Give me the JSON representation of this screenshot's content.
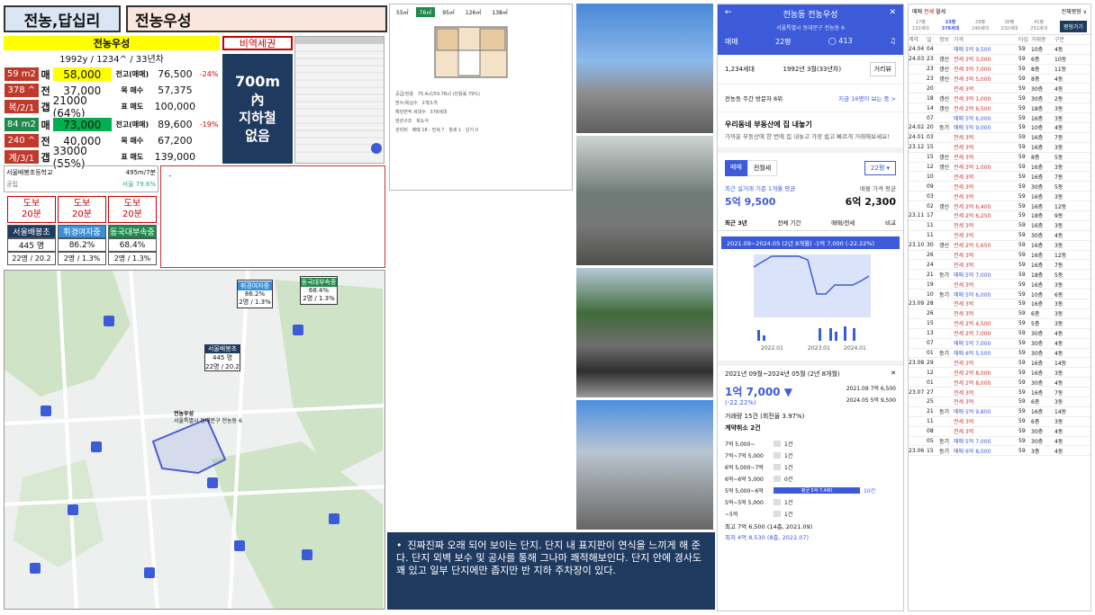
{
  "header": {
    "title": "전농,답십리",
    "complex": "전농우성"
  },
  "info": {
    "name": "전농우성",
    "year": "1992y / 1234^ / 33년차",
    "bidx": "비역세권",
    "subway": [
      "700m",
      "內",
      "지하철",
      "없음"
    ],
    "rows": [
      {
        "left": "59 m2",
        "k": "매",
        "v": "58,000",
        "n": "전고(매매)",
        "p": "76,500",
        "r": "-24%",
        "lc": "#c0392b",
        "vc": "#ffff00"
      },
      {
        "left": "378 ^",
        "k": "전",
        "v": "37,000",
        "n": "목 매수",
        "p": "57,375",
        "r": "",
        "lc": "#c0392b",
        "vc": "#fff"
      },
      {
        "left": "복/2/1",
        "k": "갭",
        "v": "21000 (64%)",
        "n": "표 매도",
        "p": "100,000",
        "r": "",
        "lc": "#c0392b",
        "vc": "#fff"
      },
      {
        "left": "84 m2",
        "k": "매",
        "v": "73,000",
        "n": "전고(매매)",
        "p": "89,600",
        "r": "-19%",
        "lc": "#1f8a4c",
        "vc": "#00b050"
      },
      {
        "left": "240 ^",
        "k": "전",
        "v": "40,000",
        "n": "목 매수",
        "p": "67,200",
        "r": "",
        "lc": "#c0392b",
        "vc": "#fff"
      },
      {
        "left": "계/3/1",
        "k": "갭",
        "v": "33000 (55%)",
        "n": "표 매도",
        "p": "139,000",
        "r": "",
        "lc": "#c0392b",
        "vc": "#fff"
      }
    ]
  },
  "school": {
    "name": "서울배봉초등학교",
    "dist": "495m/7분",
    "tag": "공립",
    "sub": "서울 79.6%"
  },
  "walk": [
    {
      "l1": "도보",
      "l2": "20분"
    },
    {
      "l1": "도보",
      "l2": "20분"
    },
    {
      "l1": "도보",
      "l2": "20분"
    }
  ],
  "schools": [
    {
      "name": "서울배봉초",
      "pct": "445 명",
      "ratio": "22명 / 20.2",
      "color": "#1f3a5f"
    },
    {
      "name": "휘경여자중",
      "pct": "86.2%",
      "ratio": "2명 / 1.3%",
      "color": "#3a8fd8"
    },
    {
      "name": "동국대부속중",
      "pct": "68.4%",
      "ratio": "2명 / 1.3%",
      "color": "#1f8a4c"
    }
  ],
  "map": {
    "m1": [
      "휘경여자중",
      "86.2%",
      "2명 / 1.3%"
    ],
    "m2": [
      "동국대부속중",
      "68.4%",
      "2명 / 1.3%"
    ],
    "m3": [
      "서울배봉초",
      "445 명",
      "22명 / 20.2"
    ],
    "complex": "전농우성",
    "addr": "서울특별시 동대문구 전농동 6"
  },
  "plan": {
    "tabs": [
      "55㎡",
      "76㎡",
      "95㎡",
      "126㎡",
      "138㎡"
    ]
  },
  "note": "진짜진짜 오래 되어 보이는 단지. 단지 내 표지판이 연식을 느끼게 해 준다. 단지 외벽 보수 및 공사를 통해 그나마 쾌적해보인다. 단지 안에 경사도 꽤 있고 일부 단지에만 좁지만 반 지하 주차장이 있다.",
  "app": {
    "title": "전농동 전농우성",
    "addr": "서울특별시 동대문구 전농동 6",
    "trade": "매매",
    "size": "22평",
    "count": "413",
    "households": "1,234세대",
    "built": "1992년 3월(33년차)",
    "btn": "거리뷰",
    "visit": "전농동 주간 방문자 8위",
    "visit_link": "지금 16명이 보는 중 >",
    "ad_title": "우리동네 부동산에 집 내놓기",
    "ad_body": "가까운 부동산에 한 번에 집 내놓고 가장 쉽고 빠르게 거래해보세요!",
    "tabs": [
      "매매",
      "전월세"
    ],
    "size2": "22평 ▾",
    "recent_label": "최근 실거래 기준 1개월 평균",
    "recent_val": "5억 9,500",
    "ask_label": "매물 가격 평균",
    "ask_val": "6억 2,300",
    "ptabs": [
      "최근 3년",
      "전체 기간",
      "매매/전세",
      "비교"
    ],
    "range": "2021.09~2024.05 (2년 8개월)  -1억 7,000 (-22.22%)",
    "xaxis": [
      "2022.01",
      "2023.01",
      "2024.01"
    ],
    "sum_title": "2021년 09월~2024년 05월 (2년 8개월)",
    "sum_val": "1억 7,000 ▼",
    "sum_pct": "(-22.22%)",
    "sum_a": "2021.09  7억 6,500",
    "sum_b": "2024.05  5억 9,500",
    "cnt": "거래량 15건 (회전율 3.97%)",
    "cancel": "계약취소 2건",
    "bands": [
      [
        "7억 5,000~",
        "1건"
      ],
      [
        "7억~7억 5,000",
        "1건"
      ],
      [
        "6억 5,000~7억",
        "1건"
      ],
      [
        "6억~6억 5,000",
        "0건"
      ],
      [
        "5억 5,000~6억",
        "10건"
      ],
      [
        "5억~5억 5,000",
        "1건"
      ],
      [
        "~5억",
        "1건"
      ]
    ],
    "bar_label": "평균 5억 7,480",
    "hi": "최고 7억 6,500 (14층, 2021.09)",
    "lo": "최저 4억 8,530 (8층, 2022.07)"
  },
  "list": {
    "tabs": [
      "매매",
      "전세",
      "월세"
    ],
    "filter": "전체평형 ∨",
    "sizes": [
      [
        "17평",
        "132세대"
      ],
      [
        "23평",
        "378세대"
      ],
      [
        "29평",
        "240세대"
      ],
      [
        "30평",
        "232세대"
      ],
      [
        "41평",
        "252세대"
      ]
    ],
    "btn": "평형가기",
    "head": [
      "계약",
      "일",
      "정보",
      "가격",
      "타입",
      "거래층",
      "구분"
    ],
    "rows": [
      [
        "24.04",
        "04",
        "",
        "매매 5억 9,500",
        "59",
        "10층",
        "4동"
      ],
      [
        "24.03",
        "23",
        "갱신",
        "전세 3억 3,000",
        "59",
        "6층",
        "10동"
      ],
      [
        "",
        "23",
        "갱신",
        "전세 3억 7,000",
        "59",
        "8층",
        "11동"
      ],
      [
        "",
        "23",
        "갱신",
        "전세 3억 5,000",
        "59",
        "8층",
        "4동"
      ],
      [
        "",
        "20",
        "",
        "전세 3억",
        "59",
        "30층",
        "4동"
      ],
      [
        "",
        "18",
        "갱신",
        "전세 3억 1,000",
        "59",
        "30층",
        "2동"
      ],
      [
        "",
        "14",
        "갱신",
        "전세 2억 6,500",
        "59",
        "18층",
        "3동"
      ],
      [
        "",
        "07",
        "",
        "매매 5억 6,000",
        "59",
        "16층",
        "3동"
      ],
      [
        "24.02",
        "20",
        "등기",
        "매매 5억 9,000",
        "59",
        "10층",
        "4동"
      ],
      [
        "24.01",
        "03",
        "",
        "전세 3억",
        "59",
        "16층",
        "7동"
      ],
      [
        "23.12",
        "15",
        "",
        "전세 3억",
        "59",
        "16층",
        "3동"
      ],
      [
        "",
        "15",
        "갱신",
        "전세 3억",
        "59",
        "8층",
        "5동"
      ],
      [
        "",
        "12",
        "갱신",
        "전세 3억 1,000",
        "59",
        "16층",
        "3동"
      ],
      [
        "",
        "10",
        "",
        "전세 3억",
        "59",
        "16층",
        "7동"
      ],
      [
        "",
        "09",
        "",
        "전세 3억",
        "59",
        "30층",
        "5동"
      ],
      [
        "",
        "03",
        "",
        "전세 3억",
        "59",
        "16층",
        "3동"
      ],
      [
        "",
        "02",
        "갱신",
        "전세 2억 6,400",
        "59",
        "16층",
        "12동"
      ],
      [
        "23.11",
        "17",
        "",
        "전세 2억 6,250",
        "59",
        "18층",
        "9동"
      ],
      [
        "",
        "11",
        "",
        "전세 3억",
        "59",
        "16층",
        "3동"
      ],
      [
        "",
        "11",
        "",
        "전세 3억",
        "59",
        "30층",
        "4동"
      ],
      [
        "23.10",
        "30",
        "갱신",
        "전세 2억 5,650",
        "59",
        "16층",
        "3동"
      ],
      [
        "",
        "26",
        "",
        "전세 3억",
        "59",
        "16층",
        "12동"
      ],
      [
        "",
        "24",
        "",
        "전세 3억",
        "59",
        "16층",
        "7동"
      ],
      [
        "",
        "21",
        "등기",
        "매매 5억 7,000",
        "59",
        "18층",
        "5동"
      ],
      [
        "",
        "19",
        "",
        "전세 3억",
        "59",
        "16층",
        "3동"
      ],
      [
        "",
        "10",
        "등기",
        "매매 5억 6,000",
        "59",
        "10층",
        "6동"
      ],
      [
        "23.09",
        "28",
        "",
        "전세 3억",
        "59",
        "16층",
        "3동"
      ],
      [
        "",
        "26",
        "",
        "전세 3억",
        "59",
        "6층",
        "3동"
      ],
      [
        "",
        "15",
        "",
        "전세 2억 4,500",
        "59",
        "5층",
        "3동"
      ],
      [
        "",
        "13",
        "",
        "전세 2억 7,000",
        "59",
        "30층",
        "4동"
      ],
      [
        "",
        "07",
        "",
        "매매 5억 7,000",
        "59",
        "30층",
        "4동"
      ],
      [
        "",
        "01",
        "등기",
        "매매 6억 5,500",
        "59",
        "30층",
        "4동"
      ],
      [
        "23.08",
        "29",
        "",
        "전세 3억",
        "59",
        "16층",
        "14동"
      ],
      [
        "",
        "12",
        "",
        "전세 2억 8,000",
        "59",
        "16층",
        "3동"
      ],
      [
        "",
        "01",
        "",
        "전세 2억 8,000",
        "59",
        "30층",
        "4동"
      ],
      [
        "23.07",
        "27",
        "",
        "전세 3억",
        "59",
        "16층",
        "7동"
      ],
      [
        "",
        "25",
        "",
        "전세 3억",
        "59",
        "6층",
        "3동"
      ],
      [
        "",
        "21",
        "등기",
        "매매 5억 9,800",
        "59",
        "16층",
        "14동"
      ],
      [
        "",
        "11",
        "",
        "전세 3억",
        "59",
        "6층",
        "3동"
      ],
      [
        "",
        "08",
        "",
        "전세 3억",
        "59",
        "30층",
        "4동"
      ],
      [
        "",
        "05",
        "등기",
        "매매 5억 7,000",
        "59",
        "30층",
        "4동"
      ],
      [
        "23.06",
        "15",
        "등기",
        "매매 6억 8,000",
        "59",
        "3층",
        "4동"
      ]
    ]
  }
}
